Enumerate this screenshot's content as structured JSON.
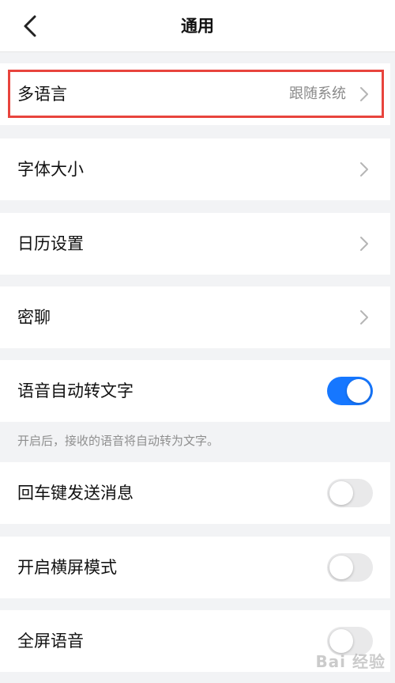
{
  "header": {
    "title": "通用",
    "back_icon": "chevron-left-icon"
  },
  "rows": [
    {
      "label": "多语言",
      "value": "跟随系统",
      "type": "nav"
    },
    {
      "label": "字体大小",
      "type": "nav"
    },
    {
      "label": "日历设置",
      "type": "nav"
    },
    {
      "label": "密聊",
      "type": "nav"
    },
    {
      "label": "语音自动转文字",
      "type": "toggle",
      "on": true
    },
    {
      "label": "回车键发送消息",
      "type": "toggle",
      "on": false
    },
    {
      "label": "开启横屏模式",
      "type": "toggle",
      "on": false
    },
    {
      "label": "全屏语音",
      "type": "toggle",
      "on": false
    }
  ],
  "hint": "开启后，接收的语音将自动转为文字。",
  "watermark": "Bai 经验",
  "colors": {
    "accent": "#1677ff",
    "highlight": "#e8443d",
    "background": "#f2f3f5"
  }
}
